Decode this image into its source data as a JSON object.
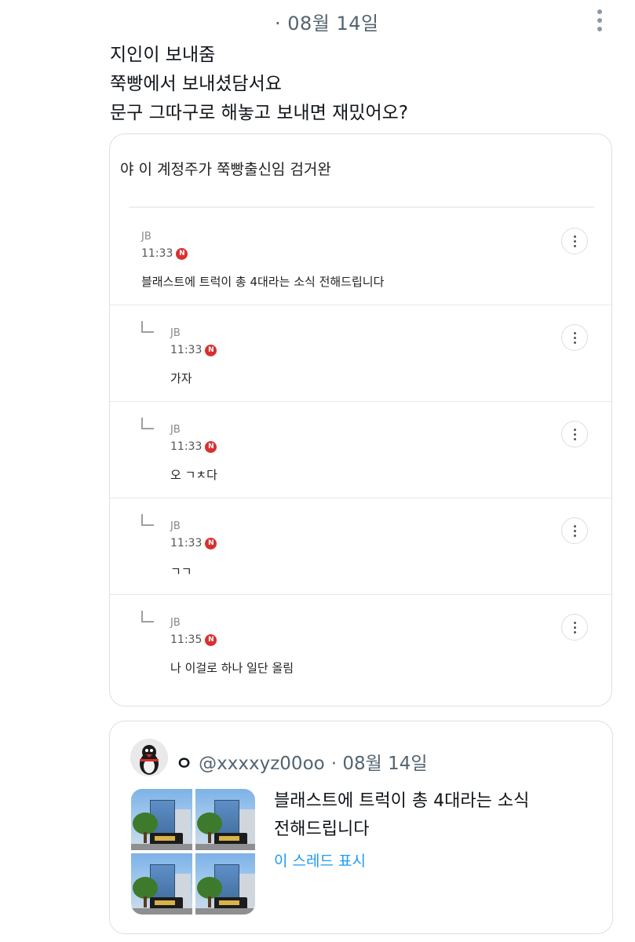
{
  "header": {
    "date": "· 08월 14일"
  },
  "post": {
    "lines": "지인이 보내줌\n쭉빵에서 보내셨담서요\n문구 그따구로 해놓고 보내면 재밌어오?"
  },
  "quoted_screenshot": {
    "title": "야 이 계정주가 쭉빵출신임 검거완",
    "comments": [
      {
        "name": "JB",
        "time": "11:33",
        "badge": "N",
        "text": "블래스트에 트럭이 총 4대라는 소식 전해드립니다",
        "reply": false
      },
      {
        "name": "JB",
        "time": "11:33",
        "badge": "N",
        "text": "가자",
        "reply": true
      },
      {
        "name": "JB",
        "time": "11:33",
        "badge": "N",
        "text": "오 ㄱㅊ다",
        "reply": true
      },
      {
        "name": "JB",
        "time": "11:33",
        "badge": "N",
        "text": "ㄱㄱ",
        "reply": true
      },
      {
        "name": "JB",
        "time": "11:35",
        "badge": "N",
        "text": "나 이걸로 하나 일단 올림",
        "reply": true
      }
    ]
  },
  "embed": {
    "display_name": "ㅇ",
    "handle": "@xxxxyz00oo",
    "date": "· 08월 14일",
    "text": "블래스트에 트럭이 총 4대라는 소식\n전해드립니다",
    "link_label": "이 스레드 표시"
  }
}
